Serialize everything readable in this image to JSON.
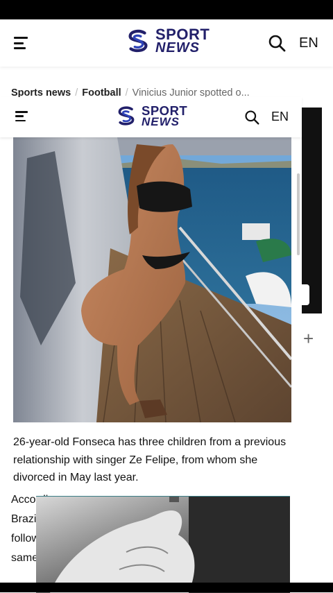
{
  "header": {
    "logo_line1": "SPORT",
    "logo_line2": "NEWS",
    "lang": "EN"
  },
  "breadcrumb": {
    "items": [
      "Sports news",
      "Football",
      "Vinicius Junior spotted o..."
    ]
  },
  "caption": "26-year-old Fonseca has three children from a previous relationship with singer Ze Felipe, from whom she divorced in May last year.",
  "article_fragment": [
    "According",
    "Brazilian",
    "followe",
    "same"
  ],
  "side_widget": {
    "plus": "+"
  },
  "colors": {
    "brand": "#22206a",
    "brand_accent": "#2e43b8",
    "statusbar": "#000000"
  }
}
